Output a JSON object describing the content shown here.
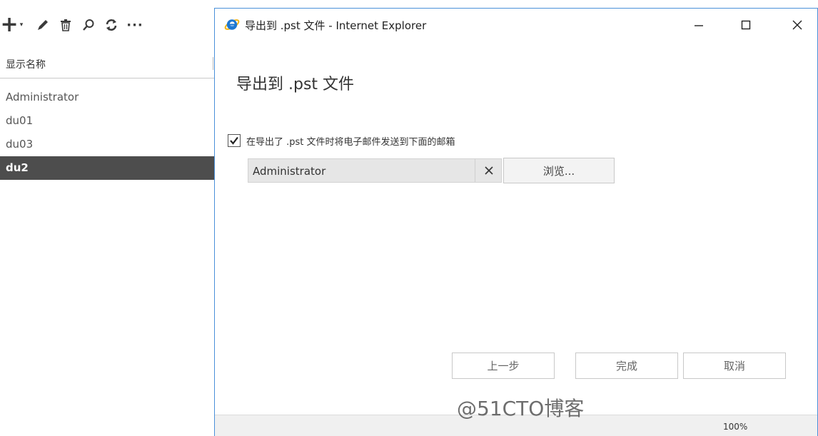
{
  "left_pane": {
    "toolbar": {
      "add_symbol": "+",
      "add_caret": "▾",
      "more_symbol": "···",
      "icons": [
        "add-icon",
        "edit-icon",
        "delete-icon",
        "search-icon",
        "refresh-icon",
        "more-icon"
      ]
    },
    "column_header": "显示名称",
    "users": [
      {
        "name": "Administrator"
      },
      {
        "name": "du01"
      },
      {
        "name": "du03"
      },
      {
        "name": "du2",
        "selected": true
      }
    ]
  },
  "window": {
    "title": "导出到 .pst 文件 - Internet Explorer",
    "icon": "internet-explorer-icon",
    "controls": [
      "minimize-icon",
      "maximize-icon",
      "close-icon"
    ]
  },
  "page": {
    "heading": "导出到 .pst 文件",
    "email_option": {
      "checked": true,
      "label": "在导出了 .pst 文件时将电子邮件发送到下面的邮箱"
    },
    "recipient": {
      "value": "Administrator",
      "clear_symbol": "✕"
    },
    "browse_label": "浏览...",
    "buttons": {
      "back": "上一步",
      "finish": "完成",
      "cancel": "取消"
    }
  },
  "status_bar": {
    "zoom": "100%"
  },
  "watermark": "@51CTO博客",
  "colors": {
    "selection": "#4d4d4d",
    "window_border": "#4a90d9",
    "ie_blue": "#1e78d2",
    "ie_ring": "#f2b417"
  }
}
